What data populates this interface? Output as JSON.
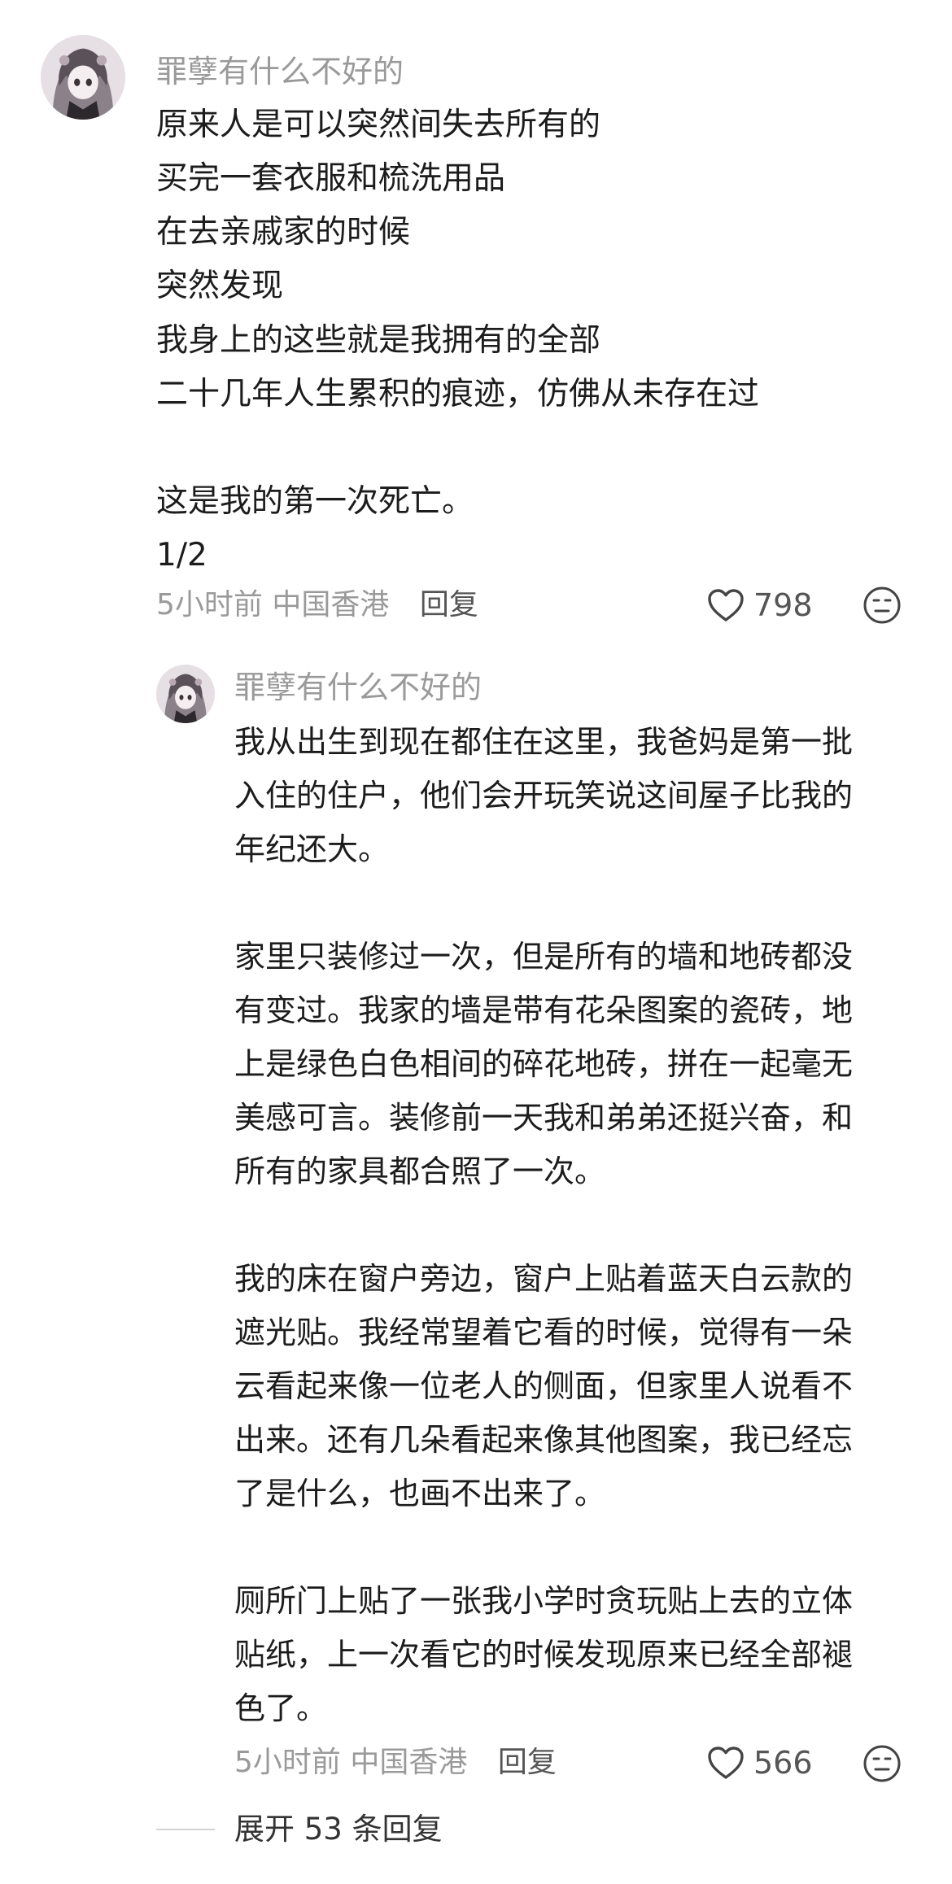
{
  "comment1": {
    "username": "罪孽有什么不好的",
    "lines": [
      "原来人是可以突然间失去所有的",
      "买完一套衣服和梳洗用品",
      "在去亲戚家的时候",
      "突然发现",
      "我身上的这些就是我拥有的全部",
      "二十几年人生累积的痕迹，仿佛从未存在过",
      "这是我的第一次死亡。",
      "1/2"
    ],
    "time": "5小时前",
    "location": "中国香港",
    "reply_label": "回复",
    "likes": "798"
  },
  "comment2": {
    "username": "罪孽有什么不好的",
    "lines": [
      "我从出生到现在都住在这里，我爸妈是第一批",
      "入住的住户，他们会开玩笑说这间屋子比我的",
      "年纪还大。",
      "家里只装修过一次，但是所有的墙和地砖都没",
      "有变过。我家的墙是带有花朵图案的瓷砖，地",
      "上是绿色白色相间的碎花地砖，拼在一起毫无",
      "美感可言。装修前一天我和弟弟还挺兴奋，和",
      "所有的家具都合照了一次。",
      "我的床在窗户旁边，窗户上贴着蓝天白云款的",
      "遮光贴。我经常望着它看的时候，觉得有一朵",
      "云看起来像一位老人的侧面，但家里人说看不",
      "出来。还有几朵看起来像其他图案，我已经忘",
      "了是什么，也画不出来了。",
      "厕所门上贴了一张我小学时贪玩贴上去的立体",
      "贴纸，上一次看它的时候发现原来已经全部褪",
      "色了。"
    ],
    "time": "5小时前",
    "location": "中国香港",
    "reply_label": "回复",
    "likes": "566"
  },
  "expand_replies": "展开 53 条回复",
  "icons": {
    "like": "heart-outline-icon",
    "react": "neutral-face-icon"
  },
  "colors": {
    "meta_gray": "#9a9a9a",
    "text": "#1c1c1c"
  }
}
